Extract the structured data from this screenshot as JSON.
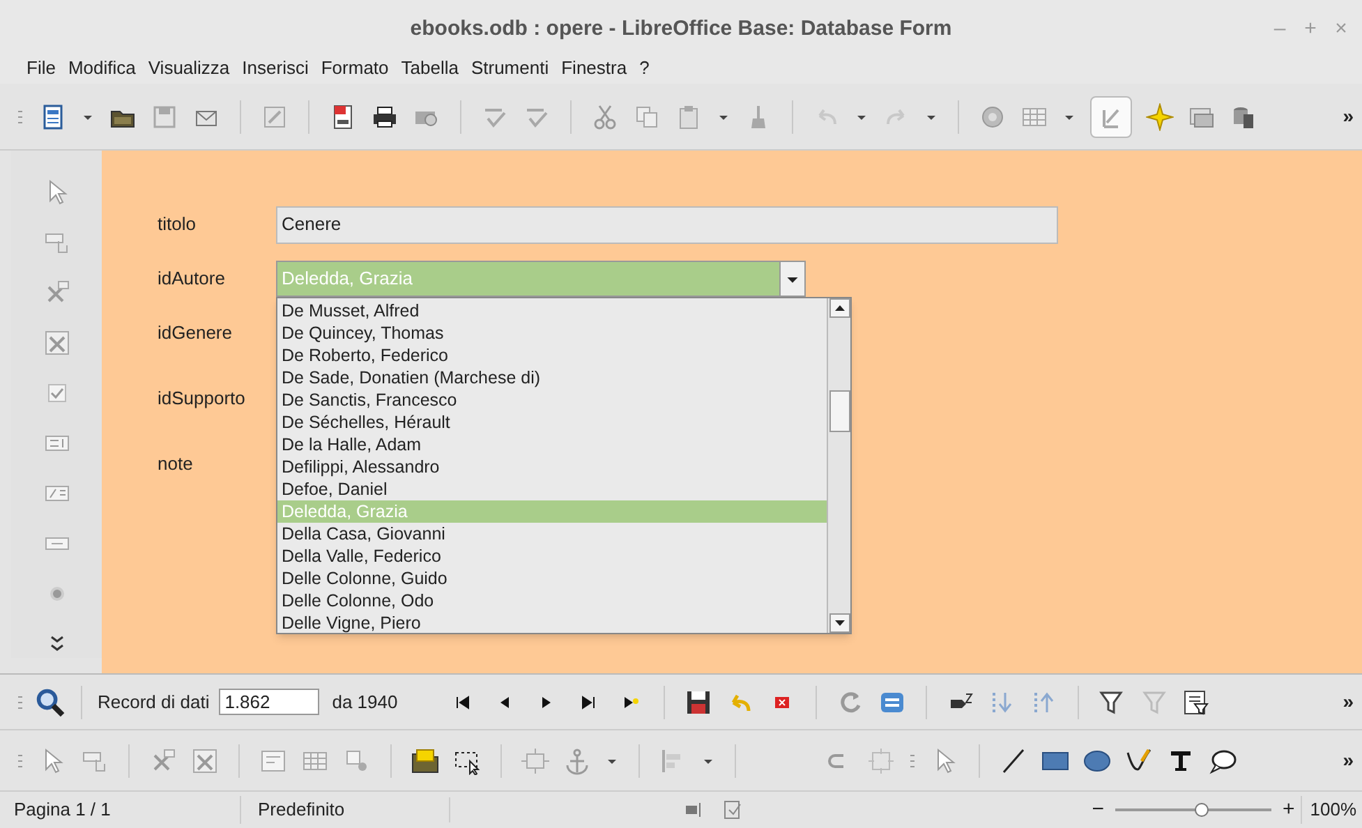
{
  "window": {
    "title": "ebooks.odb : opere - LibreOffice Base: Database Form",
    "controls": [
      "–",
      "+",
      "×"
    ]
  },
  "menu": [
    "File",
    "Modifica",
    "Visualizza",
    "Inserisci",
    "Formato",
    "Tabella",
    "Strumenti",
    "Finestra",
    "?"
  ],
  "toolbar": {
    "overflow": "»"
  },
  "form": {
    "fields": [
      {
        "label": "titolo",
        "kind": "text",
        "value": "Cenere"
      },
      {
        "label": "idAutore",
        "kind": "combo",
        "value": "Deledda, Grazia"
      },
      {
        "label": "idGenere",
        "kind": "hidden"
      },
      {
        "label": "idSupporto",
        "kind": "hidden"
      },
      {
        "label": "note",
        "kind": "hidden"
      }
    ],
    "dropdown": [
      {
        "text": "De Musset, Alfred",
        "selected": false
      },
      {
        "text": "De Quincey, Thomas",
        "selected": false
      },
      {
        "text": "De Roberto, Federico",
        "selected": false
      },
      {
        "text": "De Sade, Donatien (Marchese di)",
        "selected": false
      },
      {
        "text": "De Sanctis, Francesco",
        "selected": false
      },
      {
        "text": "De Séchelles, Hérault",
        "selected": false
      },
      {
        "text": "De la Halle, Adam",
        "selected": false
      },
      {
        "text": "Defilippi, Alessandro",
        "selected": false
      },
      {
        "text": "Defoe, Daniel",
        "selected": false
      },
      {
        "text": "Deledda, Grazia",
        "selected": true
      },
      {
        "text": "Della Casa, Giovanni",
        "selected": false
      },
      {
        "text": "Della Valle, Federico",
        "selected": false
      },
      {
        "text": "Delle Colonne, Guido",
        "selected": false
      },
      {
        "text": "Delle Colonne, Odo",
        "selected": false
      },
      {
        "text": "Delle Vigne, Piero",
        "selected": false
      }
    ]
  },
  "navigation": {
    "record_label": "Record di dati",
    "record_value": "1.862",
    "total": "da 1940",
    "overflow": "»"
  },
  "design_toolbar": {
    "overflow": "»"
  },
  "status_bar": {
    "page": "Pagina 1 / 1",
    "style": "Predefinito",
    "zoom_minus": "−",
    "zoom_plus": "+",
    "zoom_slider": {
      "level": 0.55
    },
    "zoom": "100%"
  }
}
